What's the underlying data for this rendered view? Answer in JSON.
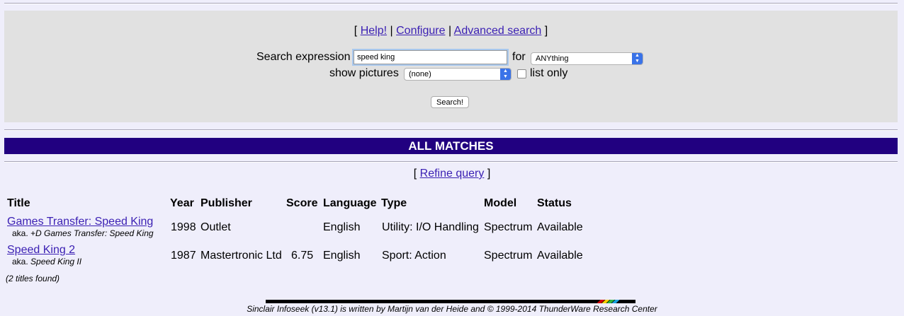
{
  "search_panel": {
    "links": {
      "open": "[",
      "help": "Help!",
      "sep1": "|",
      "configure": "Configure",
      "sep2": "|",
      "advanced": "Advanced search",
      "close": "]"
    },
    "search_expression_label": "Search expression",
    "search_value": "speed king",
    "for_label": "for",
    "for_select_value": "ANYthing",
    "show_pictures_label": "show pictures",
    "pictures_select_value": "(none)",
    "list_only_label": "list only",
    "list_only_checked": false,
    "search_button": "Search!"
  },
  "banner": "ALL MATCHES",
  "refine": {
    "open": "[",
    "link": "Refine query",
    "close": "]"
  },
  "table": {
    "headers": [
      "Title",
      "Year",
      "Publisher",
      "Score",
      "Language",
      "Type",
      "Model",
      "Status"
    ],
    "rows": [
      {
        "title": "Games Transfer: Speed King",
        "aka_prefix": "aka.",
        "aka": "+D Games Transfer: Speed King",
        "year": "1998",
        "publisher": "Outlet",
        "score": "",
        "language": "English",
        "type": "Utility: I/O Handling",
        "model": "Spectrum",
        "status": "Available"
      },
      {
        "title": "Speed King 2",
        "aka_prefix": "aka.",
        "aka": "Speed King II",
        "year": "1987",
        "publisher": "Mastertronic Ltd",
        "score": "6.75",
        "language": "English",
        "type": "Sport: Action",
        "model": "Spectrum",
        "status": "Available"
      }
    ]
  },
  "titles_found": "(2 titles found)",
  "footer": "Sinclair Infoseek (v13.1) is written by Martijn van der Heide and © 1999-2014 ThunderWare Research Center",
  "colors": {
    "page_bg": "#efeefb",
    "banner_bg": "#210080",
    "link": "#3a1fb3",
    "panel_bg": "#e1e1e1"
  }
}
